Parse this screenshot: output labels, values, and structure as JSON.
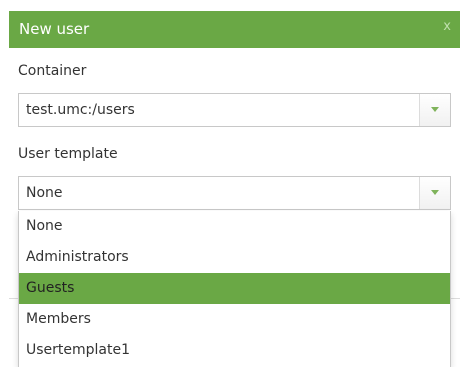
{
  "dialog": {
    "title": "New user",
    "close_icon": "close-icon",
    "close_glyph": "x"
  },
  "container_field": {
    "label": "Container",
    "value": "test.umc:/users",
    "arrow_icon": "chevron-down-icon"
  },
  "template_field": {
    "label": "User template",
    "value": "None",
    "arrow_icon": "chevron-down-icon",
    "options": [
      {
        "label": "None",
        "selected": false
      },
      {
        "label": "Administrators",
        "selected": false
      },
      {
        "label": "Guests",
        "selected": true
      },
      {
        "label": "Members",
        "selected": false
      },
      {
        "label": "Usertemplate1",
        "selected": false
      }
    ]
  },
  "colors": {
    "accent": "#6aa845",
    "arrow": "#7fb35b",
    "border": "#c8c8c8"
  }
}
